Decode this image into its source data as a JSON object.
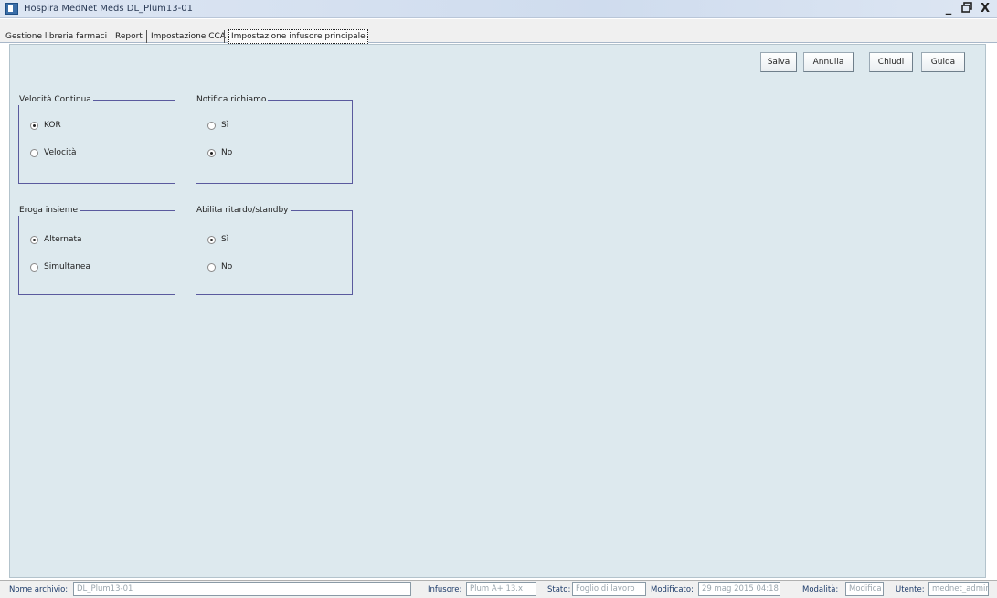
{
  "window": {
    "title": "Hospira MedNet Meds  DL_Plum13-01",
    "controls": [
      "_",
      "ȧ",
      "X"
    ]
  },
  "tabs": [
    {
      "label": "Gestione libreria farmaci",
      "active": false
    },
    {
      "label": "Report",
      "active": false
    },
    {
      "label": "Impostazione CCA",
      "active": false
    },
    {
      "label": "Impostazione infusore principale",
      "active": true
    }
  ],
  "toolbar": {
    "save": "Salva",
    "cancel": "Annulla",
    "close": "Chiudi",
    "help": "Guida"
  },
  "groups": {
    "continuous_rate": {
      "title": "Velocità Continua",
      "options": [
        {
          "label": "KOR",
          "checked": true
        },
        {
          "label": "Velocità",
          "checked": false
        }
      ]
    },
    "callback_notification": {
      "title": "Notifica richiamo",
      "options": [
        {
          "label": "Sì",
          "checked": false
        },
        {
          "label": "No",
          "checked": true
        }
      ]
    },
    "deliver_together": {
      "title": "Eroga insieme",
      "options": [
        {
          "label": "Alternata",
          "checked": true
        },
        {
          "label": "Simultanea",
          "checked": false
        }
      ]
    },
    "delay_standby": {
      "title": "Abilita ritardo/standby",
      "options": [
        {
          "label": "Sì",
          "checked": true
        },
        {
          "label": "No",
          "checked": false
        }
      ]
    }
  },
  "status": {
    "archive_label": "Nome archivio:",
    "archive_value": "DL_Plum13-01",
    "infuser_label": "Infusore:",
    "infuser_value": "Plum A+ 13.x",
    "state_label": "Stato:",
    "state_value": "Foglio di lavoro",
    "modified_label": "Modificato:",
    "modified_value": "29 mag 2015 04:18",
    "mode_label": "Modalità:",
    "mode_value": "Modifica",
    "user_label": "Utente:",
    "user_value": "mednet_admin"
  },
  "colors": {
    "panel_bg": "#dde9ee",
    "group_border": "#5a5a9e",
    "status_label": "#1d3b6a"
  }
}
